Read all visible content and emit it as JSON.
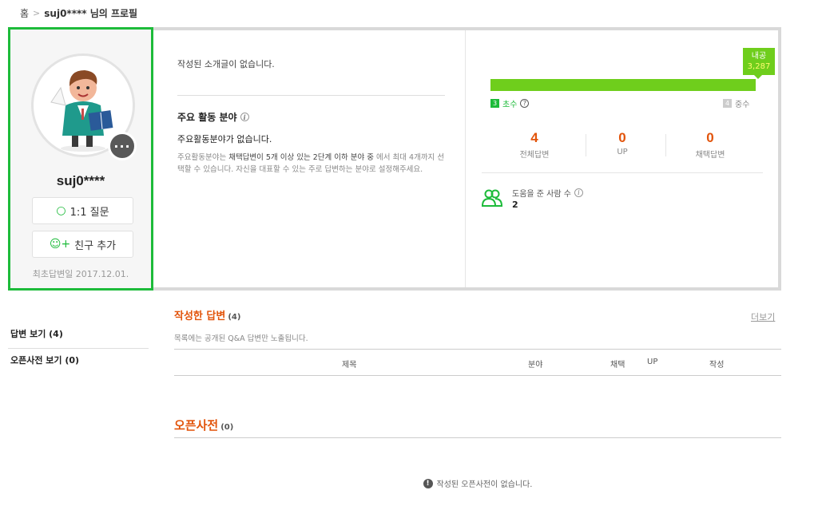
{
  "breadcrumb": {
    "home": "홈",
    "current": "suj0**** 님의 프로필"
  },
  "profile": {
    "nickname": "suj0****",
    "more_label": "···",
    "question_button": "1:1 질문",
    "add_friend_button": "친구 추가",
    "first_answer": "최초답변일 2017.12.01.",
    "intro": "작성된 소개글이 없습니다.",
    "area_title": "주요 활동 분야",
    "area_none": "주요활동분야가 없습니다.",
    "area_desc_1": "주요활동분야는 ",
    "area_desc_bold": "채택답변이 5개 이상 있는 2단계 이하 분야 중",
    "area_desc_2": " 에서 최대 4개까지 선택할 수 있습니다. 자신을 대표할 수 있는 주로 답변하는 분야로 설정해주세요."
  },
  "level": {
    "badge_label": "내공",
    "badge_value": "3,287",
    "current_num": "3",
    "current_name": "초수",
    "next_num": "4",
    "next_name": "중수",
    "progress": 1.0
  },
  "stats": [
    {
      "value": "4",
      "label": "전체답변",
      "color": "#e2540b"
    },
    {
      "value": "0",
      "label": "UP",
      "color": "#e2540b"
    },
    {
      "value": "0",
      "label": "채택답변",
      "color": "#e2540b"
    }
  ],
  "helper": {
    "label": "도움을 준 사람 수",
    "value": "2"
  },
  "nav": {
    "answers": "답변 보기 (4)",
    "dict": "오픈사전 보기 (0)"
  },
  "answers_section": {
    "title": "작성한 답변",
    "count": "(4)",
    "more": "더보기",
    "subtitle": "목록에는 공개된 Q&A 답변만 노출됩니다.",
    "columns": [
      "제목",
      "분야",
      "채택",
      "UP",
      "작성"
    ]
  },
  "dict_section": {
    "title": "오픈사전",
    "count": "(0)",
    "empty": "작성된 오픈사전이 없습니다."
  },
  "colors": {
    "accent_green": "#1dbb3a",
    "level_green": "#6fce1c",
    "orange": "#e2540b"
  }
}
